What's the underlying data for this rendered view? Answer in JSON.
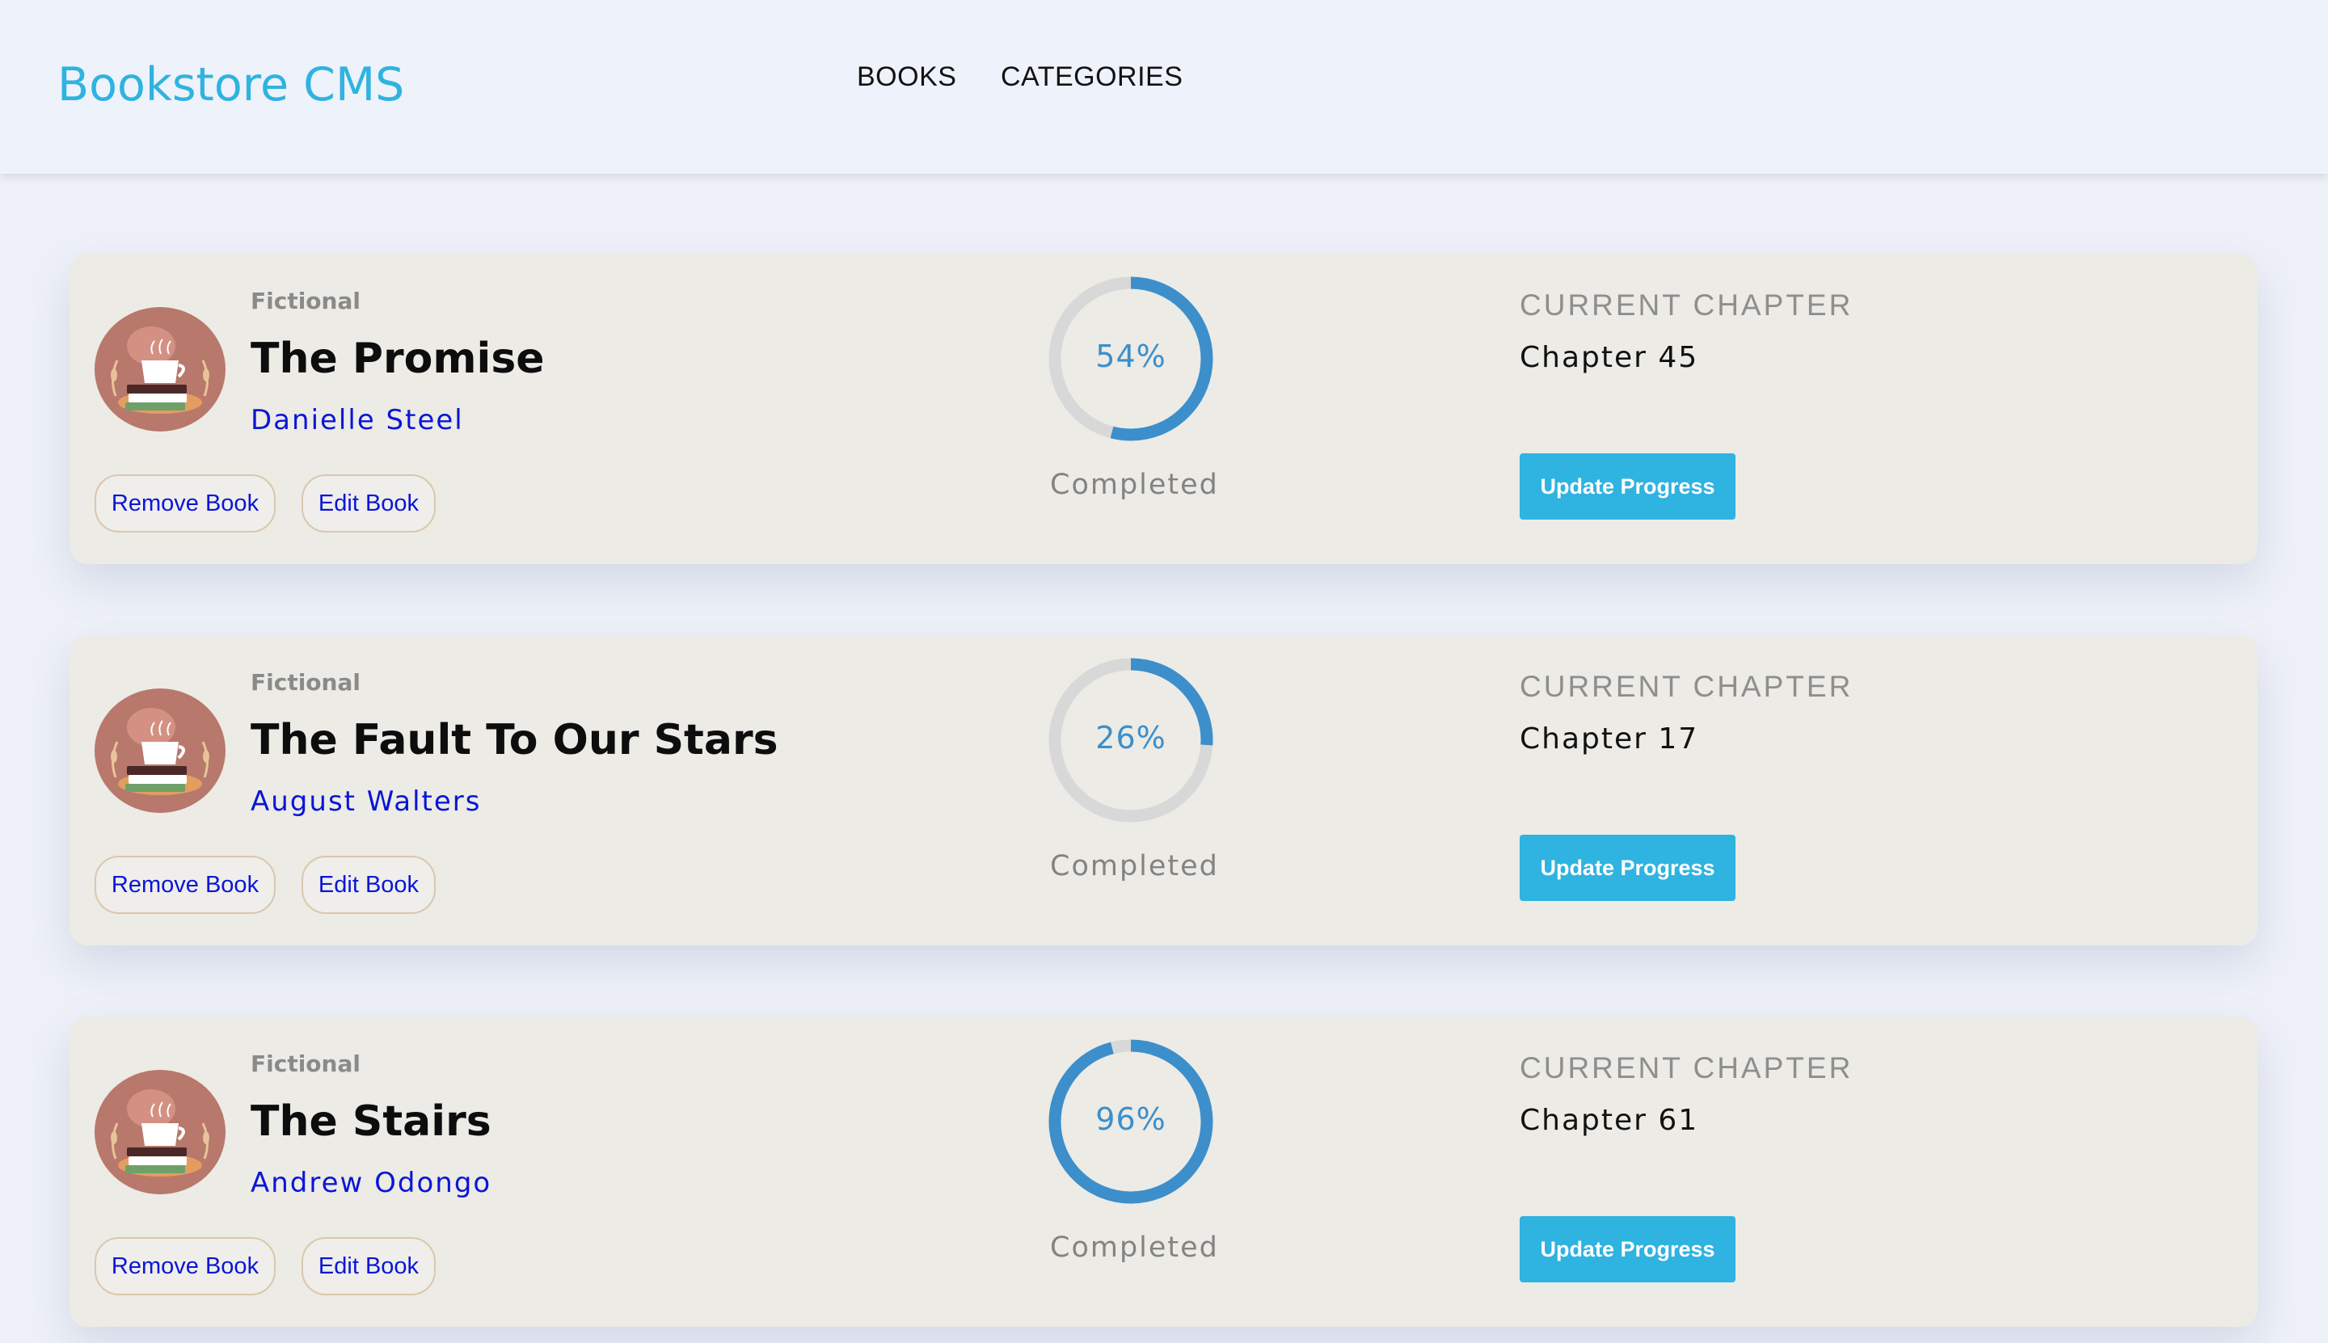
{
  "header": {
    "brand": "Bookstore CMS",
    "nav": [
      {
        "label": "BOOKS"
      },
      {
        "label": "CATEGORIES"
      }
    ]
  },
  "books": [
    {
      "genre": "Fictional",
      "title": "The Promise",
      "author": "Danielle Steel",
      "remove_label": "Remove Book",
      "edit_label": "Edit Book",
      "progress": 54,
      "progress_label": "54%",
      "completed_label": "Completed",
      "chapter_label": "CURRENT CHAPTER",
      "chapter": "Chapter 45",
      "update_label": "Update Progress"
    },
    {
      "genre": "Fictional",
      "title": "The Fault To Our Stars",
      "author": "August Walters",
      "remove_label": "Remove Book",
      "edit_label": "Edit Book",
      "progress": 26,
      "progress_label": "26%",
      "completed_label": "Completed",
      "chapter_label": "CURRENT CHAPTER",
      "chapter": "Chapter 17",
      "update_label": "Update Progress"
    },
    {
      "genre": "Fictional",
      "title": "The Stairs",
      "author": "Andrew Odongo",
      "remove_label": "Remove Book",
      "edit_label": "Edit Book",
      "progress": 96,
      "progress_label": "96%",
      "completed_label": "Completed",
      "chapter_label": "CURRENT CHAPTER",
      "chapter": "Chapter 61",
      "update_label": "Update Progress"
    }
  ],
  "colors": {
    "accent": "#2fb3e0",
    "ring_fill": "#3c8fca",
    "ring_track": "#d8d8d8",
    "author": "#0a16d6",
    "card_bg": "#ecebe6",
    "page_bg": "#eef1f8"
  },
  "icons": {
    "avatar": "coffee-books-avatar-icon"
  }
}
